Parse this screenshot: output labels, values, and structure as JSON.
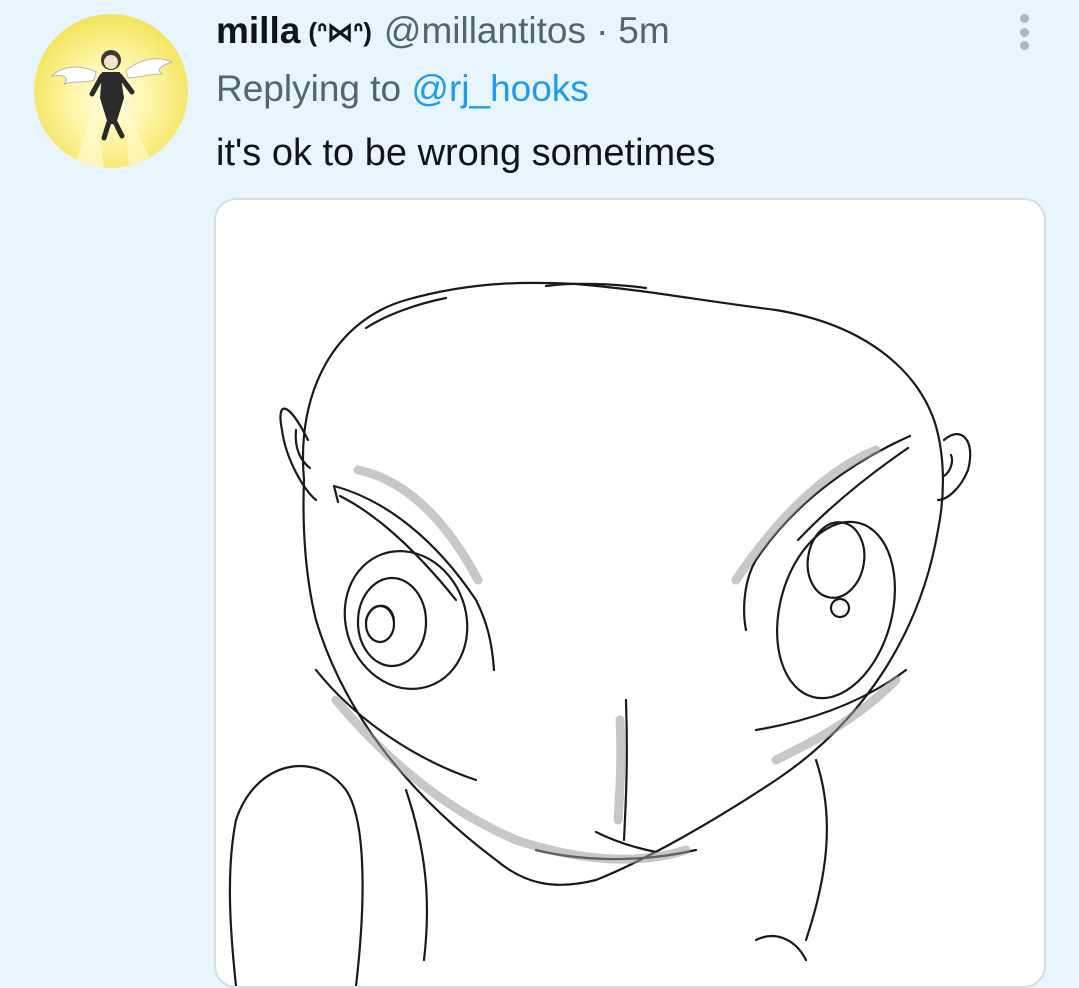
{
  "tweet": {
    "display_name": "milla",
    "kaomoji": "(ᐢ⋈ᐢ)",
    "handle": "@millantitos",
    "separator": "·",
    "time": "5m",
    "replying_prefix": "Replying to",
    "replying_handle": "@rj_hooks",
    "text": "it's ok to be wrong sometimes"
  },
  "icons": {
    "avatar": "angel-avatar",
    "more": "more-options-icon"
  },
  "colors": {
    "background": "#e8f5fd",
    "link": "#1d9bf0",
    "secondary_text": "#536471",
    "primary_text": "#0f1419"
  }
}
